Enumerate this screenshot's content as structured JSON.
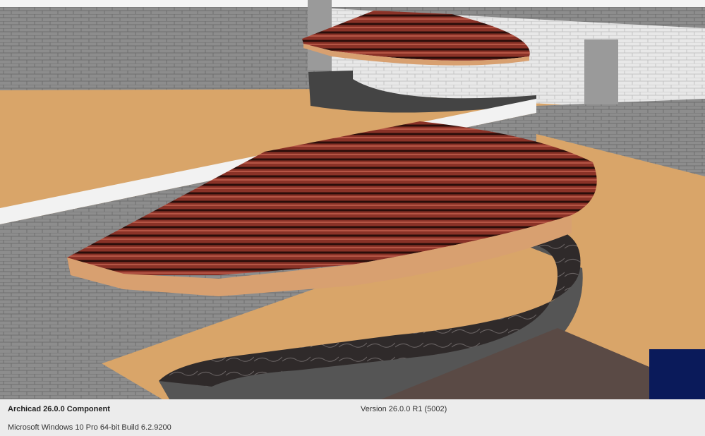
{
  "footer": {
    "product": "Archicad 26.0.0 Component",
    "version": "Version 26.0.0 R1 (5002)",
    "os": "Microsoft Windows 10 Pro 64-bit Build 6.2.9200"
  },
  "colors": {
    "ground": "#d9a569",
    "wall": "#8e8e8e",
    "roof": "#7a2a22",
    "fascia": "#d8a070",
    "counter": "#2e2a2a",
    "footer_bg": "#ececec"
  }
}
